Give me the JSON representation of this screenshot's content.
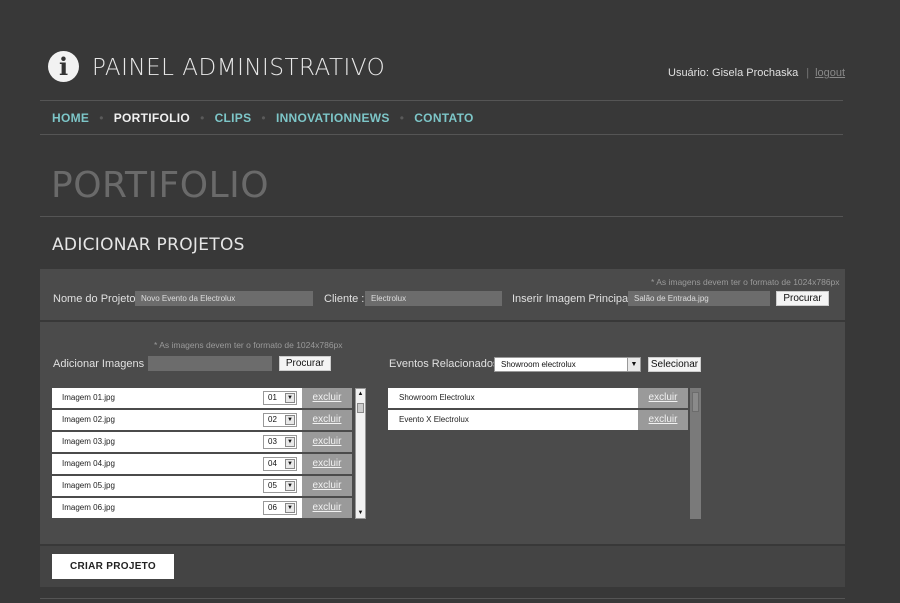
{
  "header": {
    "logo_glyph": "i",
    "app_title": "PAINEL ADMINISTRATIVO",
    "user_text": "Usuário: Gisela Prochaska",
    "separator": "|",
    "logout_label": "logout"
  },
  "nav": {
    "items": [
      {
        "label": "HOME",
        "active": false
      },
      {
        "label": "PORTIFOLIO",
        "active": true
      },
      {
        "label": "CLIPS",
        "active": false
      },
      {
        "label": "INNOVATIONNEWS",
        "active": false
      },
      {
        "label": "CONTATO",
        "active": false
      }
    ],
    "separator": "•"
  },
  "page_title": "PORTIFOLIO",
  "section_title": "ADICIONAR PROJETOS",
  "project_form": {
    "hint": "* As imagens devem ter o formato de 1024x786px",
    "project_name_label": "Nome do Projeto :",
    "project_name_value": "Novo Evento da Electrolux",
    "client_label": "Cliente :",
    "client_value": "Electrolux",
    "main_image_label": "Inserir Imagem Principal :",
    "main_image_value": "Salão de Entrada.jpg",
    "browse_label": "Procurar"
  },
  "images_form": {
    "hint": "* As imagens devem ter o formato de 1024x786px",
    "add_images_label": "Adicionar Imagens :",
    "add_images_value": "",
    "browse_label": "Procurar",
    "related_events_label": "Eventos Relacionados :",
    "related_events_selected": "Showroom electrolux",
    "select_label": "Selecionar"
  },
  "images_list": [
    {
      "name": "Imagem 01.jpg",
      "order": "01",
      "action": "excluir"
    },
    {
      "name": "Imagem 02.jpg",
      "order": "02",
      "action": "excluir"
    },
    {
      "name": "Imagem 03.jpg",
      "order": "03",
      "action": "excluir"
    },
    {
      "name": "Imagem 04.jpg",
      "order": "04",
      "action": "excluir"
    },
    {
      "name": "Imagem 05.jpg",
      "order": "05",
      "action": "excluir"
    },
    {
      "name": "Imagem 06.jpg",
      "order": "06",
      "action": "excluir"
    }
  ],
  "events_list": [
    {
      "name": "Showroom Electrolux",
      "action": "excluir"
    },
    {
      "name": "Evento X Electrolux",
      "action": "excluir"
    }
  ],
  "create_button_label": "CRIAR PROJETO",
  "icons": {
    "dropdown": "▼",
    "scroll_up": "▲",
    "scroll_down": "▼"
  },
  "colors": {
    "background": "#383838",
    "nav_link": "#7dc6c8",
    "panel": "#4b4b4b",
    "delete_cell": "#9a9a9a"
  }
}
